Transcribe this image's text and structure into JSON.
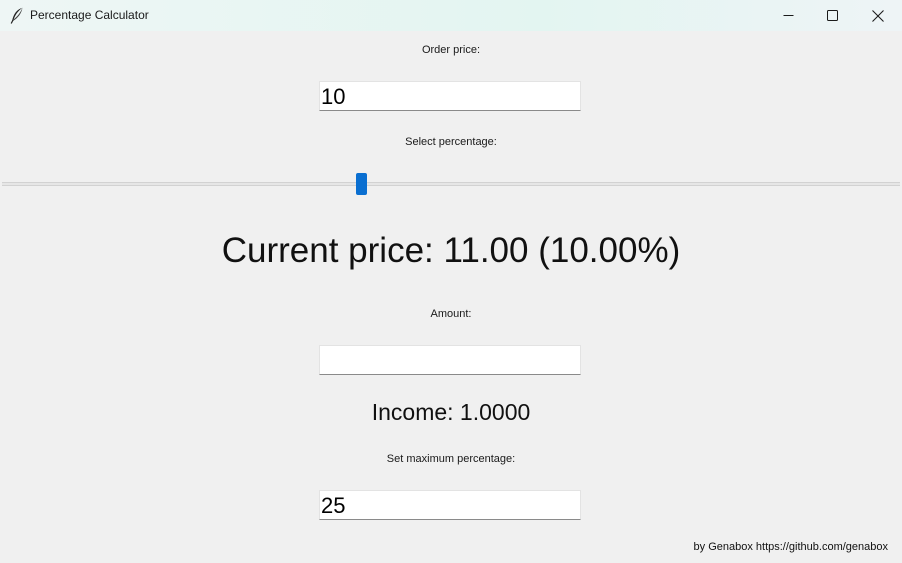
{
  "window": {
    "title": "Percentage Calculator"
  },
  "order_price": {
    "label": "Order price:",
    "value": "10"
  },
  "percentage": {
    "label": "Select percentage:",
    "slider_value_percent": 10.0,
    "slider_max_percent": 25
  },
  "current_price_text": "Current price: 11.00 (10.00%)",
  "amount": {
    "label": "Amount:",
    "value": ""
  },
  "income_text": "Income: 1.0000",
  "max_percentage": {
    "label": "Set maximum percentage:",
    "value": "25"
  },
  "footer_text": "by Genabox https://github.com/genabox",
  "colors": {
    "slider_thumb": "#0a6fd1",
    "background": "#f0f0f0"
  },
  "icons": {
    "app": "feather-icon",
    "minimize": "minimize-icon",
    "maximize": "maximize-icon",
    "close": "close-icon"
  }
}
